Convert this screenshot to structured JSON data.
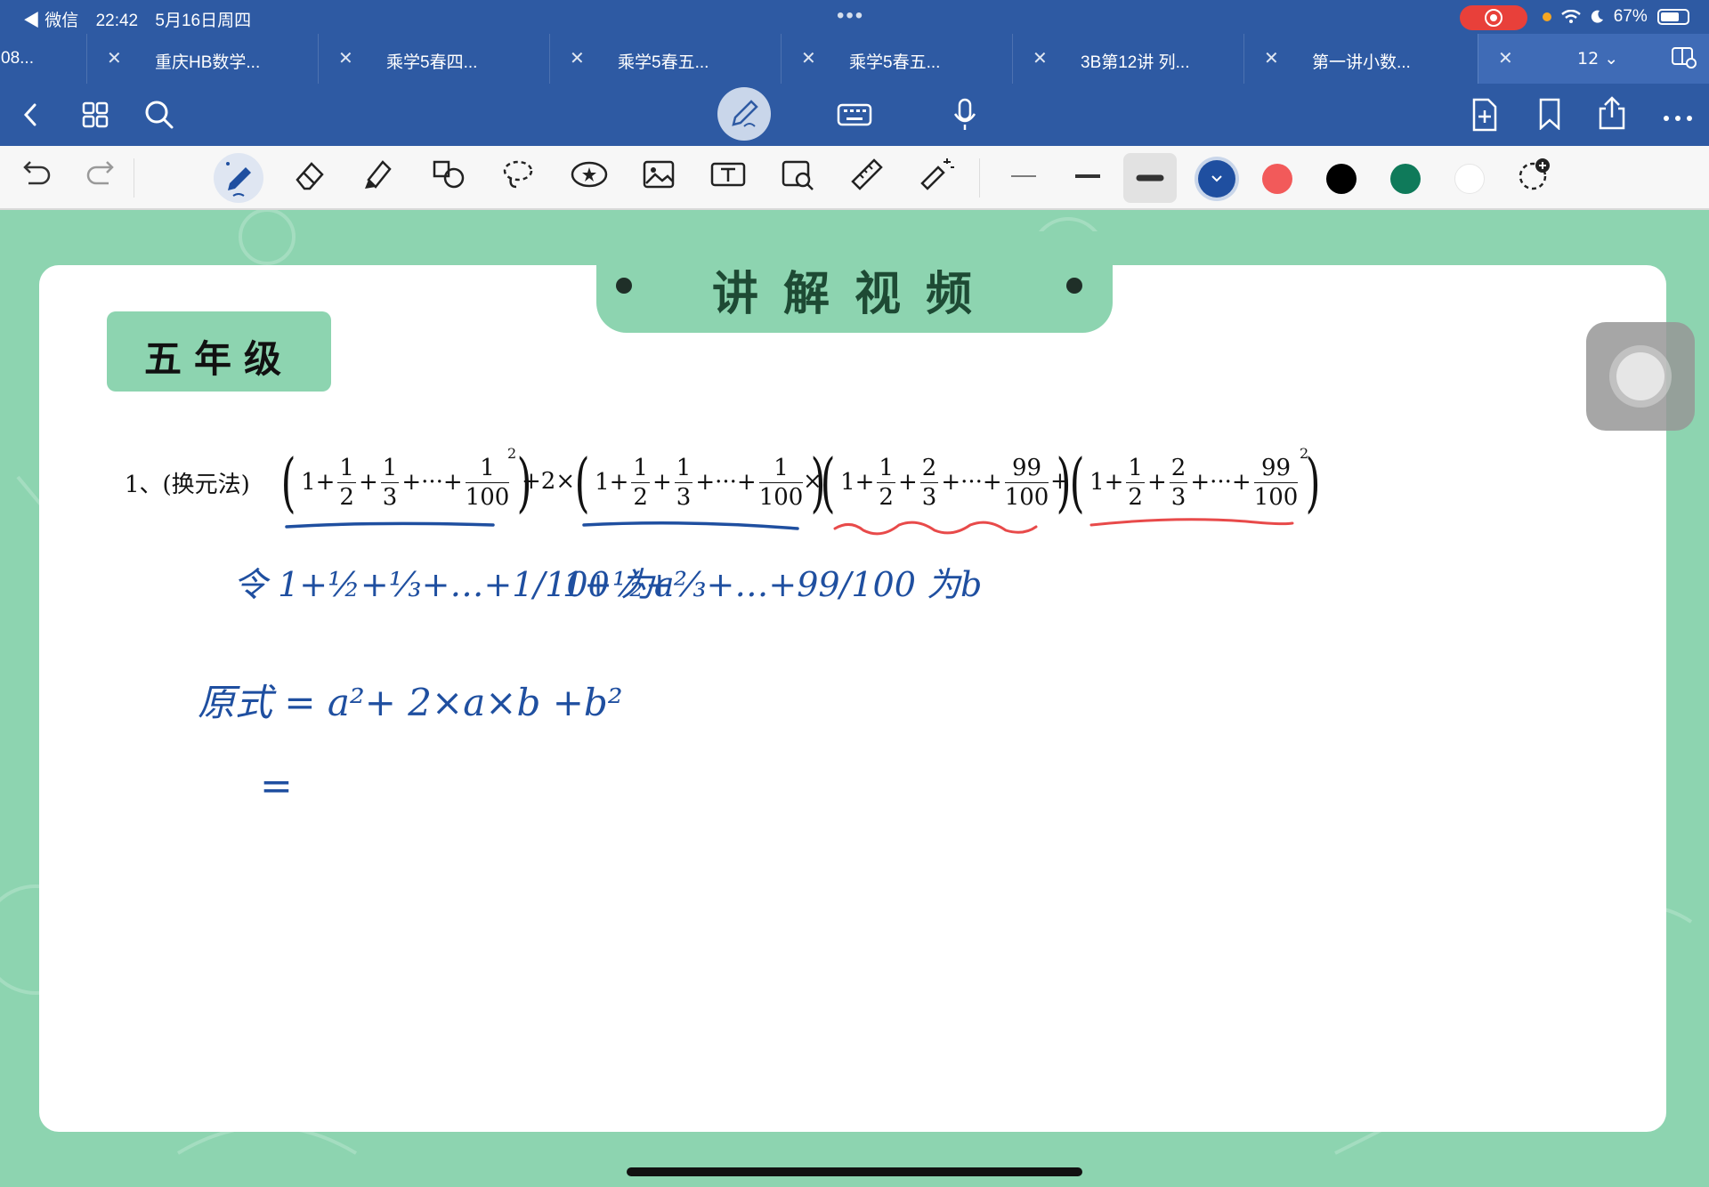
{
  "status_bar": {
    "back_app": "◀ 微信",
    "time": "22:42",
    "date": "5月16日周四",
    "battery": "67%"
  },
  "tabs": [
    {
      "label": "08..."
    },
    {
      "label": "重庆HB数学..."
    },
    {
      "label": "乘学5春四..."
    },
    {
      "label": "乘学5春五..."
    },
    {
      "label": "乘学5春五..."
    },
    {
      "label": "3B第12讲 列..."
    },
    {
      "label": "第一讲小数..."
    }
  ],
  "tab_count": "12 ⌄",
  "toolbar2": {
    "colors": [
      "#1f4fa0",
      "#f25a5a",
      "#000000",
      "#0f7a5a",
      "#ffffff"
    ]
  },
  "page": {
    "banner_title": "讲解视频",
    "grade_label": "五年级",
    "problem_prefix": "1、(换元法)",
    "problem": {
      "group1": {
        "lead": "1+",
        "fracs": [
          [
            "1",
            "2"
          ],
          [
            "1",
            "3"
          ],
          [
            "1",
            "100"
          ]
        ],
        "exponent": "2"
      },
      "op1": "+2×",
      "group2": {
        "lead": "1+",
        "fracs": [
          [
            "1",
            "2"
          ],
          [
            "1",
            "3"
          ],
          [
            "1",
            "100"
          ]
        ]
      },
      "op2": "×",
      "group3": {
        "lead": "1+",
        "fracs": [
          [
            "1",
            "2"
          ],
          [
            "2",
            "3"
          ],
          [
            "99",
            "100"
          ]
        ]
      },
      "op3": "+",
      "group4": {
        "lead": "1+",
        "fracs": [
          [
            "1",
            "2"
          ],
          [
            "2",
            "3"
          ],
          [
            "99",
            "100"
          ]
        ],
        "exponent": "2"
      },
      "dots": "+···+"
    },
    "handwriting": {
      "line1_a": "令 1+½+⅓+…+1/100 为a",
      "line1_b": "1+½+⅔+…+99/100 为b",
      "line2": "原式 = a²+ 2×a×b +b²",
      "line3": "="
    }
  }
}
